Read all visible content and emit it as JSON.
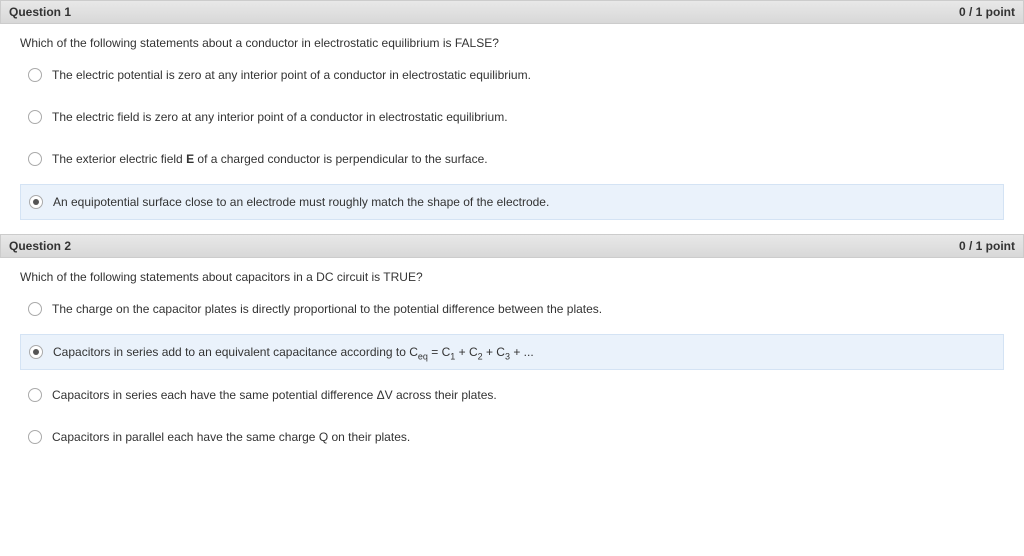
{
  "questions": [
    {
      "header": {
        "title": "Question 1",
        "points": "0 / 1 point"
      },
      "prompt": "Which of the following statements about a conductor in electrostatic equilibrium is FALSE?",
      "selected_index": 3,
      "options": [
        {
          "html": "The electric potential is zero at any interior point of a conductor in electrostatic equilibrium."
        },
        {
          "html": "The electric field is zero at any interior point of a conductor in electrostatic equilibrium."
        },
        {
          "html": "The exterior electric field <b>E</b> of a charged conductor is perpendicular to the surface."
        },
        {
          "html": "An equipotential surface close to an electrode must roughly match the shape of the electrode."
        }
      ]
    },
    {
      "header": {
        "title": "Question 2",
        "points": "0 / 1 point"
      },
      "prompt": "Which of the following statements about capacitors in a DC circuit is TRUE?",
      "selected_index": 1,
      "options": [
        {
          "html": "The charge on the capacitor plates is directly proportional to the potential difference between the plates."
        },
        {
          "html": "Capacitors in series add to an equivalent capacitance according to C<sub>eq</sub> = C<sub>1</sub> + C<sub>2</sub> + C<sub>3</sub> + ..."
        },
        {
          "html": "Capacitors in series each have the same potential difference ΔV across their plates."
        },
        {
          "html": "Capacitors in parallel each have the same charge Q on their plates."
        }
      ]
    }
  ]
}
